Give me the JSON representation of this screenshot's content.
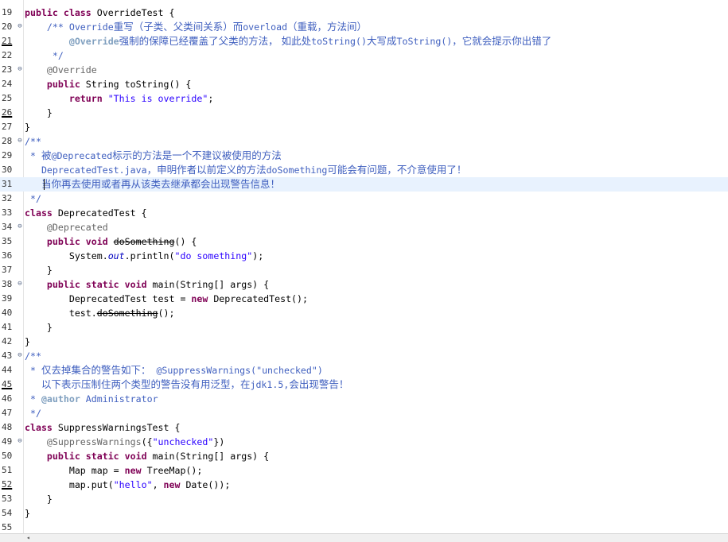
{
  "editor": {
    "icons": {
      "fold": "fold-collapse-icon",
      "scroll_left": "scroll-left-arrow-icon"
    },
    "colors": {
      "keyword": "#7f0055",
      "string": "#2a00ff",
      "comment": "#3f5fbf",
      "annotation": "#646464",
      "current_line": "#e8f2fe"
    },
    "fold_glyph": "⊖",
    "scroll_left_glyph": "◂",
    "lines": [
      {
        "n": "19",
        "fold": false,
        "segs": [
          [
            "kw",
            "public class "
          ],
          [
            "",
            "OverrideTest {"
          ]
        ]
      },
      {
        "n": "20",
        "fold": true,
        "segs": [
          [
            "cm",
            "    /** Override"
          ],
          [
            "cm cjk",
            "重写（子类、父类间关系）而"
          ],
          [
            "cm",
            "overload"
          ],
          [
            "cm cjk",
            "（重载，方法间）"
          ]
        ]
      },
      {
        "n": "21",
        "fold": false,
        "marked": true,
        "segs": [
          [
            "cm",
            "        "
          ],
          [
            "tag",
            "@Override"
          ],
          [
            "cm cjk",
            "强制的保障已经覆盖了父类的方法， 如此处"
          ],
          [
            "cm",
            "toString()"
          ],
          [
            "cm cjk",
            "大写成"
          ],
          [
            "cm",
            "ToString()"
          ],
          [
            "cm cjk",
            "，它就会提示你出错了"
          ]
        ]
      },
      {
        "n": "22",
        "fold": false,
        "segs": [
          [
            "cm",
            "     */"
          ]
        ]
      },
      {
        "n": "23",
        "fold": true,
        "segs": [
          [
            "ann",
            "    @Override"
          ]
        ]
      },
      {
        "n": "24",
        "fold": false,
        "segs": [
          [
            "kw",
            "    public "
          ],
          [
            "",
            "String toString() {"
          ]
        ]
      },
      {
        "n": "25",
        "fold": false,
        "segs": [
          [
            "kw",
            "        return "
          ],
          [
            "str",
            "\"This is override\""
          ],
          [
            "",
            ";"
          ]
        ]
      },
      {
        "n": "26",
        "fold": false,
        "marked": true,
        "segs": [
          [
            "",
            "    }"
          ]
        ]
      },
      {
        "n": "27",
        "fold": false,
        "segs": [
          [
            "",
            "}"
          ]
        ]
      },
      {
        "n": "28",
        "fold": true,
        "segs": [
          [
            "cm",
            "/**"
          ]
        ]
      },
      {
        "n": "29",
        "fold": false,
        "segs": [
          [
            "cm",
            " * "
          ],
          [
            "cm cjk",
            "被"
          ],
          [
            "cm",
            "@Deprecated"
          ],
          [
            "cm cjk",
            "标示的方法是一个不建议被使用的方法"
          ]
        ]
      },
      {
        "n": "30",
        "fold": false,
        "segs": [
          [
            "cm",
            "   DeprecatedTest.java"
          ],
          [
            "cm cjk",
            "，申明作者以前定义的方法"
          ],
          [
            "cm",
            "doSomething"
          ],
          [
            "cm cjk",
            "可能会有问题，不介意使用了！"
          ]
        ]
      },
      {
        "n": "31",
        "fold": false,
        "current": true,
        "segs": [
          [
            "cm",
            "   "
          ],
          [
            "cm cjk",
            "当你再去使用或者再从该类去继承都会出现警告信息！"
          ]
        ]
      },
      {
        "n": "32",
        "fold": false,
        "segs": [
          [
            "cm",
            " */"
          ]
        ]
      },
      {
        "n": "33",
        "fold": false,
        "segs": [
          [
            "kw",
            "class "
          ],
          [
            "",
            "DeprecatedTest {"
          ]
        ]
      },
      {
        "n": "34",
        "fold": true,
        "segs": [
          [
            "ann",
            "    @Deprecated"
          ]
        ]
      },
      {
        "n": "35",
        "fold": false,
        "segs": [
          [
            "kw",
            "    public void "
          ],
          [
            "dep",
            "doSomething"
          ],
          [
            "",
            "() {"
          ]
        ]
      },
      {
        "n": "36",
        "fold": false,
        "segs": [
          [
            "",
            "        System."
          ],
          [
            "it",
            "out"
          ],
          [
            "",
            ".println("
          ],
          [
            "str",
            "\"do something\""
          ],
          [
            "",
            ");"
          ]
        ]
      },
      {
        "n": "37",
        "fold": false,
        "segs": [
          [
            "",
            "    }"
          ]
        ]
      },
      {
        "n": "38",
        "fold": true,
        "segs": [
          [
            "kw",
            "    public static void "
          ],
          [
            "",
            "main(String[] args) {"
          ]
        ]
      },
      {
        "n": "39",
        "fold": false,
        "segs": [
          [
            "",
            "        DeprecatedTest test = "
          ],
          [
            "kw",
            "new "
          ],
          [
            "",
            "DeprecatedTest();"
          ]
        ]
      },
      {
        "n": "40",
        "fold": false,
        "segs": [
          [
            "",
            "        test."
          ],
          [
            "dep",
            "doSomething"
          ],
          [
            "",
            "();"
          ]
        ]
      },
      {
        "n": "41",
        "fold": false,
        "segs": [
          [
            "",
            "    }"
          ]
        ]
      },
      {
        "n": "42",
        "fold": false,
        "segs": [
          [
            "",
            "}"
          ]
        ]
      },
      {
        "n": "43",
        "fold": true,
        "segs": [
          [
            "cm",
            "/**"
          ]
        ]
      },
      {
        "n": "44",
        "fold": false,
        "segs": [
          [
            "cm",
            " * "
          ],
          [
            "cm cjk",
            "仅去掉集合的警告如下："
          ],
          [
            "cm",
            " @SuppressWarnings(\"unchecked\")"
          ]
        ]
      },
      {
        "n": "45",
        "fold": false,
        "marked": true,
        "segs": [
          [
            "cm",
            "   "
          ],
          [
            "cm cjk",
            "以下表示压制住两个类型的警告没有用泛型，在"
          ],
          [
            "cm",
            "jdk1.5,"
          ],
          [
            "cm cjk",
            "会出现警告！"
          ]
        ]
      },
      {
        "n": "46",
        "fold": false,
        "segs": [
          [
            "cm",
            " * "
          ],
          [
            "tag",
            "@author"
          ],
          [
            "cm",
            " Administrator"
          ]
        ]
      },
      {
        "n": "47",
        "fold": false,
        "segs": [
          [
            "cm",
            " */"
          ]
        ]
      },
      {
        "n": "48",
        "fold": false,
        "segs": [
          [
            "kw",
            "class "
          ],
          [
            "",
            "SuppressWarningsTest {"
          ]
        ]
      },
      {
        "n": "49",
        "fold": true,
        "segs": [
          [
            "ann",
            "    @SuppressWarnings"
          ],
          [
            "",
            "({"
          ],
          [
            "str",
            "\"unchecked\""
          ],
          [
            "",
            "})"
          ]
        ]
      },
      {
        "n": "50",
        "fold": false,
        "segs": [
          [
            "kw",
            "    public static void "
          ],
          [
            "",
            "main(String[] args) {"
          ]
        ]
      },
      {
        "n": "51",
        "fold": false,
        "segs": [
          [
            "",
            "        Map map = "
          ],
          [
            "kw",
            "new "
          ],
          [
            "",
            "TreeMap();"
          ]
        ]
      },
      {
        "n": "52",
        "fold": false,
        "marked": true,
        "segs": [
          [
            "",
            "        map.put("
          ],
          [
            "str",
            "\"hello\""
          ],
          [
            "",
            ", "
          ],
          [
            "kw",
            "new "
          ],
          [
            "",
            "Date());"
          ]
        ]
      },
      {
        "n": "53",
        "fold": false,
        "segs": [
          [
            "",
            "    }"
          ]
        ]
      },
      {
        "n": "54",
        "fold": false,
        "segs": [
          [
            "",
            "}"
          ]
        ]
      },
      {
        "n": "55",
        "fold": false,
        "segs": []
      }
    ]
  }
}
